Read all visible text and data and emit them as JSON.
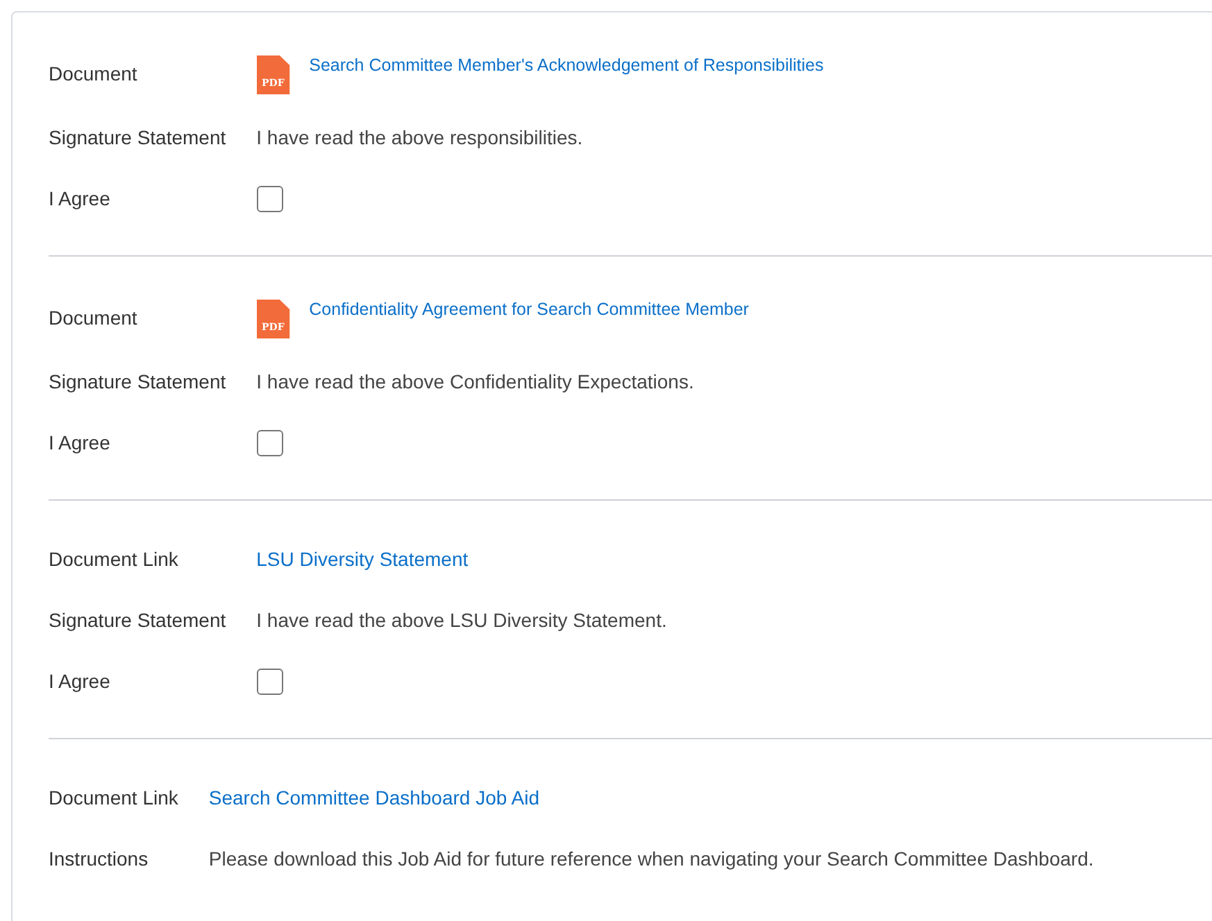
{
  "sections": [
    {
      "rows": [
        {
          "kind": "document",
          "label": "Document",
          "icon_text": "PDF",
          "link": "Search Committee Member's Acknowledgement of Responsibilities"
        },
        {
          "kind": "text",
          "label": "Signature Statement",
          "value": "I have read the above responsibilities."
        },
        {
          "kind": "checkbox",
          "label": "I Agree",
          "checked": false
        }
      ]
    },
    {
      "rows": [
        {
          "kind": "document",
          "label": "Document",
          "icon_text": "PDF",
          "link": "Confidentiality Agreement for Search Committee Member"
        },
        {
          "kind": "text",
          "label": "Signature Statement",
          "value": "I have read the above Confidentiality Expectations."
        },
        {
          "kind": "checkbox",
          "label": "I Agree",
          "checked": false
        }
      ]
    },
    {
      "rows": [
        {
          "kind": "link",
          "label": "Document Link",
          "link": "LSU Diversity Statement"
        },
        {
          "kind": "text",
          "label": "Signature Statement",
          "value": "I have read the above LSU Diversity Statement."
        },
        {
          "kind": "checkbox",
          "label": "I Agree",
          "checked": false
        }
      ]
    },
    {
      "rows": [
        {
          "kind": "link",
          "label": "Document Link",
          "link": "Search Committee Dashboard Job Aid"
        },
        {
          "kind": "text",
          "label": "Instructions",
          "value": "Please download this Job Aid for future reference when navigating your Search Committee Dashboard."
        }
      ]
    }
  ]
}
